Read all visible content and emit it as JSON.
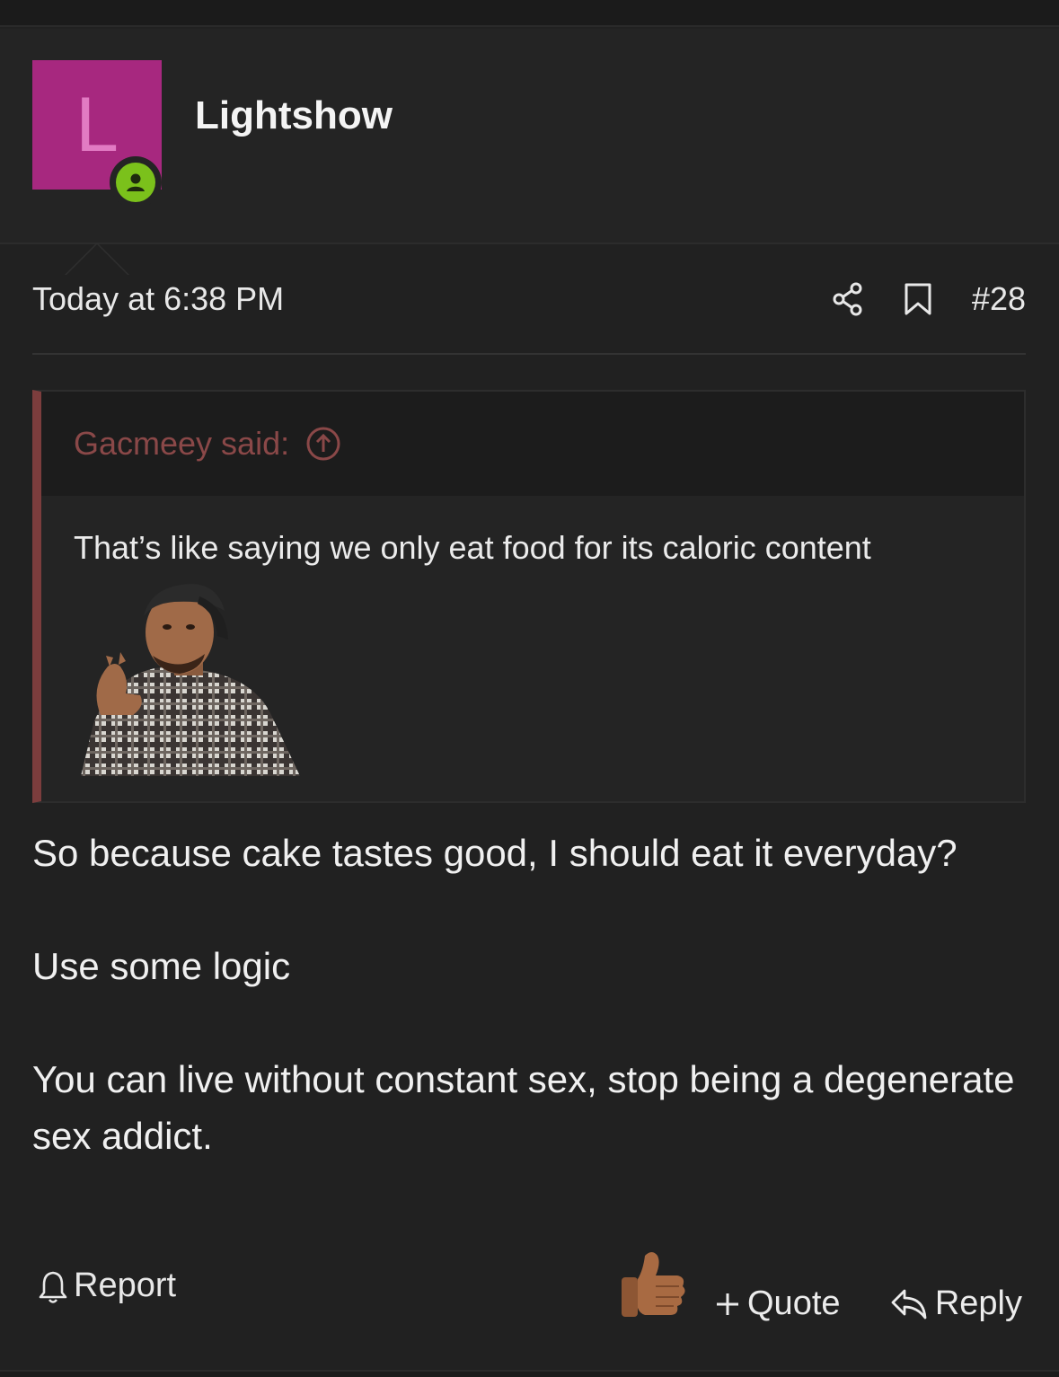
{
  "post": {
    "author": "Lightshow",
    "avatar_letter": "L",
    "avatar_color": "#a7287f",
    "online_color": "#7bc11b",
    "timestamp": "Today at 6:38 PM",
    "post_number": "#28",
    "icons": [
      "share-icon",
      "bookmark-icon"
    ]
  },
  "quote": {
    "author_line": "Gacmeey said:",
    "text": "That’s like saying we only eat food for its caloric content",
    "accent_color": "#7c3d3d"
  },
  "body": {
    "paragraphs": [
      "So because cake tastes good, I should eat it everyday?",
      "Use some logic",
      "You can live without constant sex, stop being a degenerate sex addict."
    ]
  },
  "footer": {
    "report_label": "Report",
    "quote_label": "Quote",
    "reply_label": "Reply"
  }
}
